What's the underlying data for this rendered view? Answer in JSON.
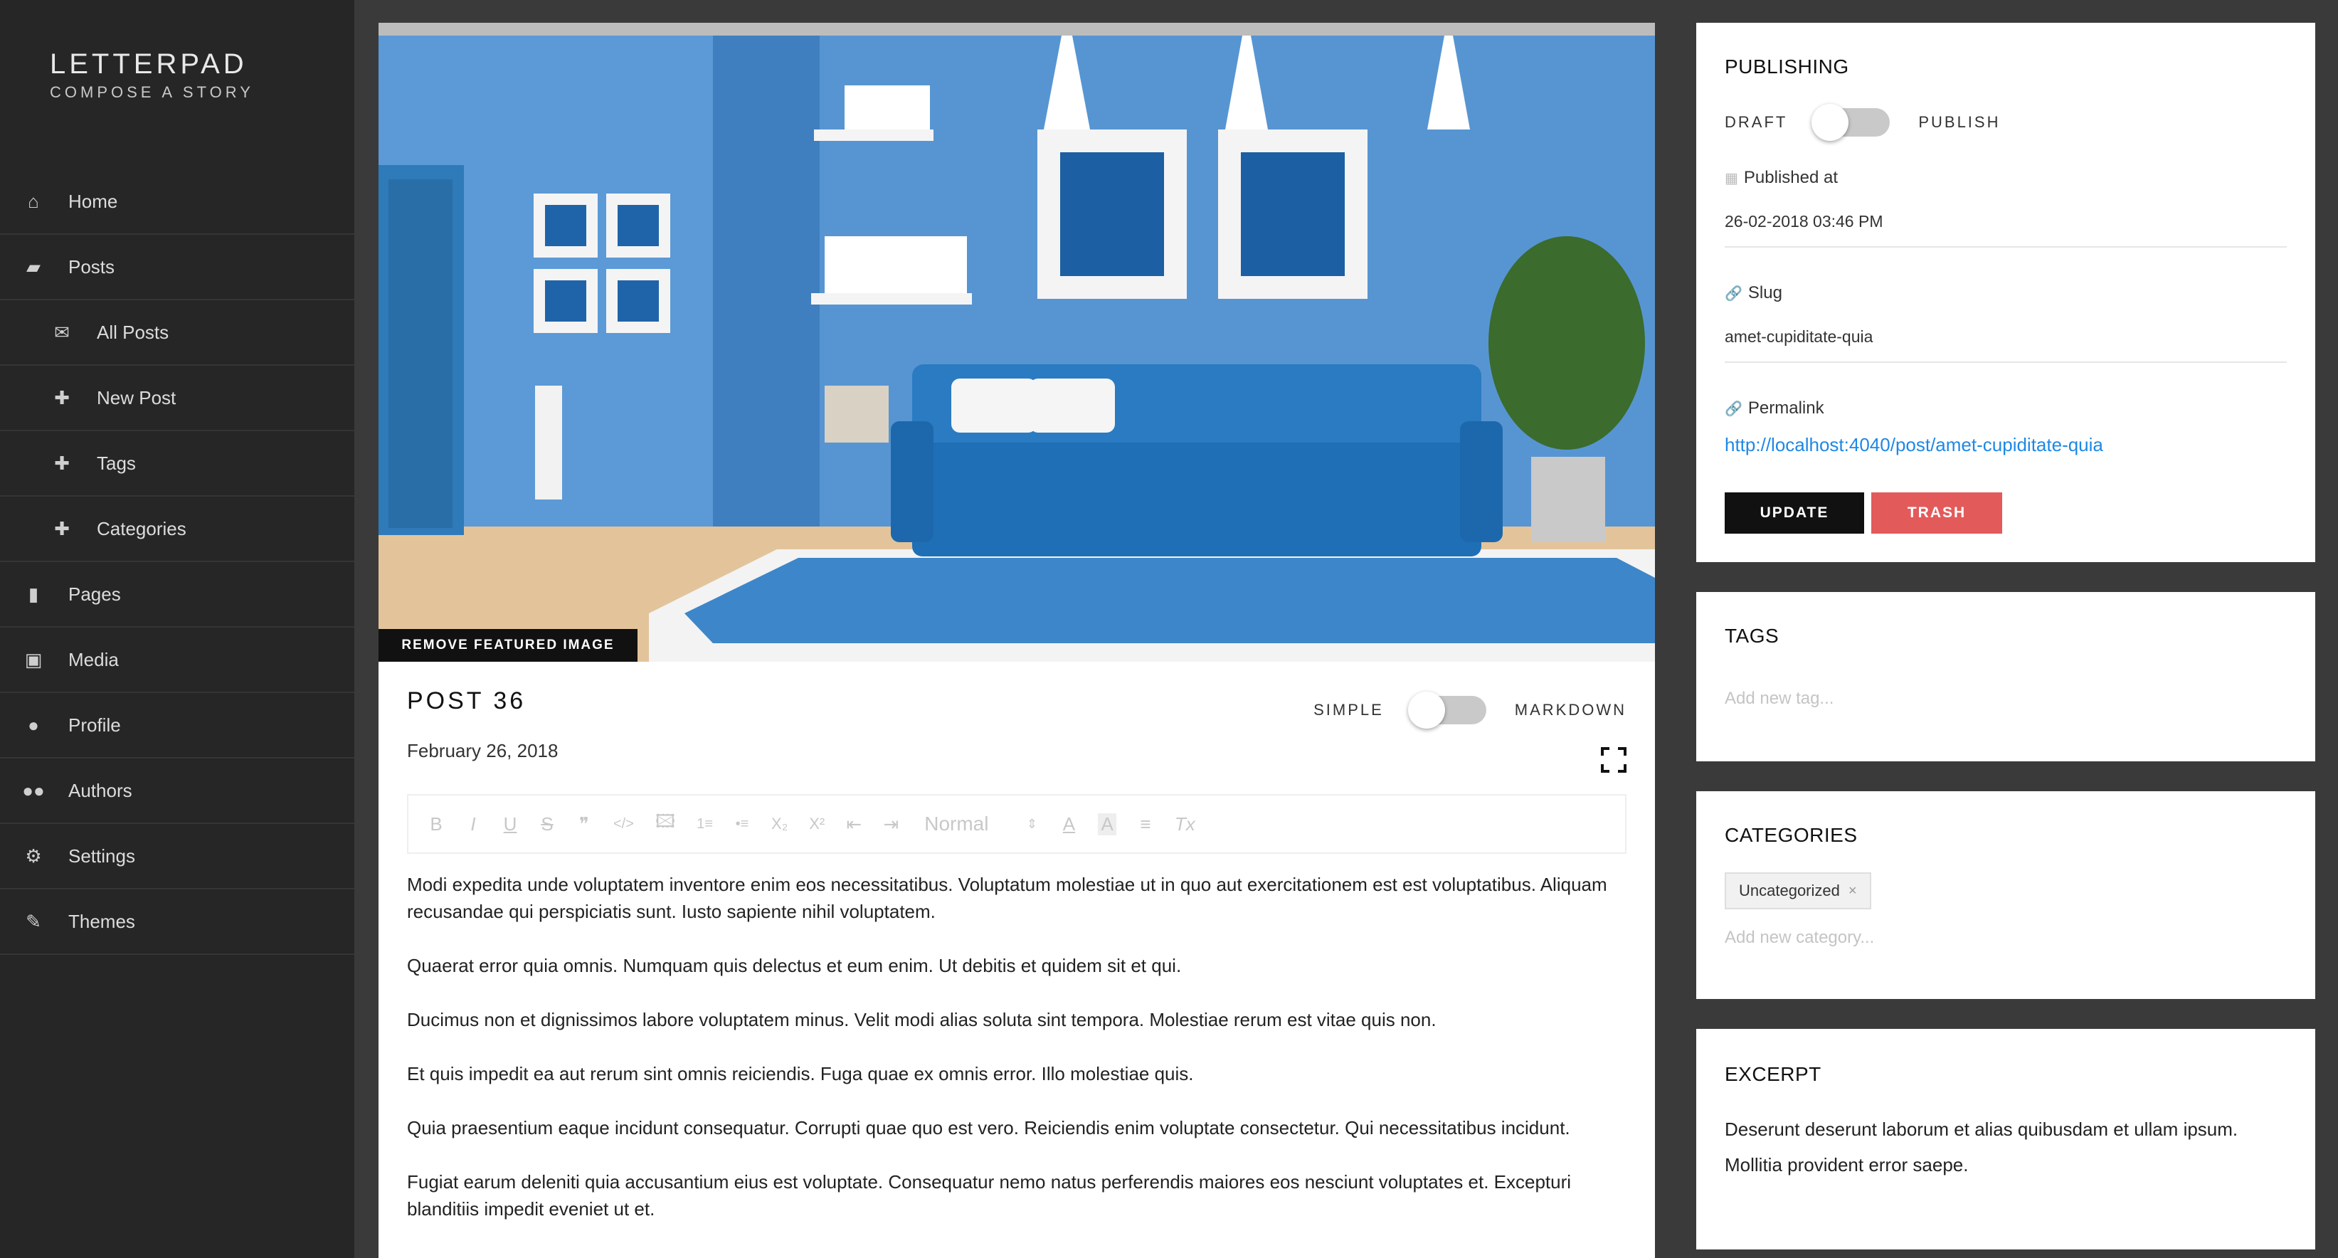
{
  "brand": {
    "title": "LETTERPAD",
    "subtitle": "COMPOSE A STORY"
  },
  "sidebar": {
    "items": [
      {
        "label": "Home",
        "icon": "home-icon"
      },
      {
        "label": "Posts",
        "icon": "book-icon"
      },
      {
        "label": "All Posts",
        "icon": "envelope-icon"
      },
      {
        "label": "New Post",
        "icon": "plus-icon"
      },
      {
        "label": "Tags",
        "icon": "plus-icon"
      },
      {
        "label": "Categories",
        "icon": "plus-icon"
      },
      {
        "label": "Pages",
        "icon": "file-icon"
      },
      {
        "label": "Media",
        "icon": "image-icon"
      },
      {
        "label": "Profile",
        "icon": "user-icon"
      },
      {
        "label": "Authors",
        "icon": "users-icon"
      },
      {
        "label": "Settings",
        "icon": "gear-icon"
      },
      {
        "label": "Themes",
        "icon": "brush-icon"
      }
    ]
  },
  "post": {
    "remove_image_label": "REMOVE FEATURED IMAGE",
    "title": "POST 36",
    "date": "February 26, 2018",
    "mode_left": "SIMPLE",
    "mode_right": "MARKDOWN",
    "mode_markdown_enabled": false
  },
  "toolbar": {
    "buttons": [
      "B",
      "I",
      "U",
      "S",
      "❞",
      "</>",
      "🖾",
      "1≡",
      "•≡",
      "X₂",
      "X²",
      "⇤",
      "⇥"
    ],
    "format_select": "Normal",
    "format_icons": [
      "A",
      "A",
      "≡",
      "Tx"
    ]
  },
  "editor": {
    "paragraphs": [
      "Modi expedita unde voluptatem inventore enim eos necessitatibus. Voluptatum molestiae ut in quo aut exercitationem est est voluptatibus. Aliquam recusandae qui perspiciatis sunt. Iusto sapiente nihil voluptatem.",
      "Quaerat error quia omnis. Numquam quis delectus et eum enim. Ut debitis et quidem sit et qui.",
      "Ducimus non et dignissimos labore voluptatem minus. Velit modi alias soluta sint tempora. Molestiae rerum est vitae quis non.",
      "Et quis impedit ea aut rerum sint omnis reiciendis. Fuga quae ex omnis error. Illo molestiae quis.",
      "Quia praesentium eaque incidunt consequatur. Corrupti quae quo est vero. Reiciendis enim voluptate consectetur. Qui necessitatibus incidunt.",
      "Fugiat earum deleniti quia accusantium eius est voluptate. Consequatur nemo natus perferendis maiores eos nesciunt voluptates et. Excepturi blanditiis impedit eveniet ut et."
    ]
  },
  "publishing": {
    "title": "PUBLISHING",
    "draft_label": "DRAFT",
    "publish_label": "PUBLISH",
    "published": false,
    "published_at_label": "Published at",
    "published_at_value": "26-02-2018 03:46 PM",
    "slug_label": "Slug",
    "slug_value": "amet-cupiditate-quia",
    "permalink_label": "Permalink",
    "permalink_value": "http://localhost:4040/post/amet-cupiditate-quia",
    "update_label": "UPDATE",
    "trash_label": "TRASH"
  },
  "tags": {
    "title": "TAGS",
    "placeholder": "Add new tag..."
  },
  "categories": {
    "title": "CATEGORIES",
    "chip": "Uncategorized",
    "chip_remove": "×",
    "placeholder": "Add new category..."
  },
  "excerpt": {
    "title": "EXCERPT",
    "text": "Deserunt deserunt laborum et alias quibusdam et ullam ipsum. Mollitia provident error saepe."
  },
  "colors": {
    "sidebar_bg": "#262626",
    "page_bg": "#3a3a3a",
    "link": "#1e88e5",
    "trash": "#e35a5a",
    "update": "#111111"
  }
}
